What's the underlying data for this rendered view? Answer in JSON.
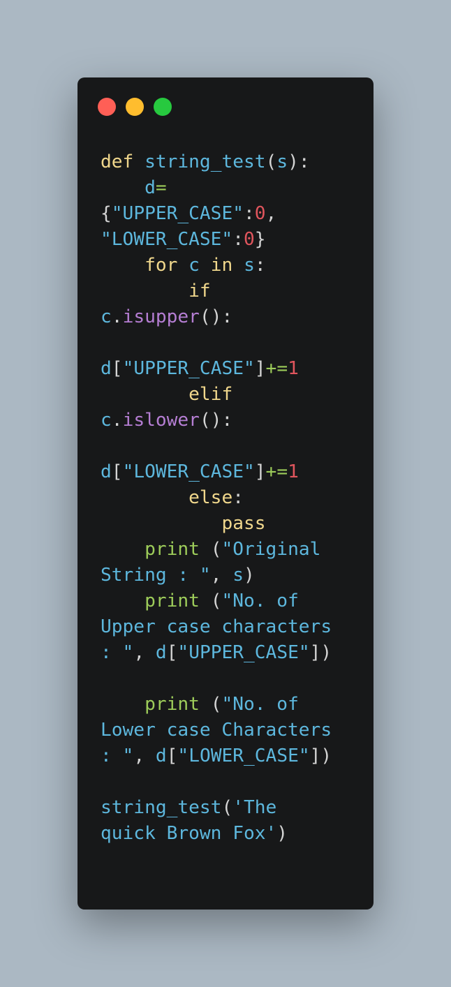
{
  "window": {
    "controls": [
      "close-button",
      "minimize-button",
      "maximize-button"
    ]
  },
  "code": {
    "language": "python",
    "lines": [
      [
        {
          "t": "kw",
          "v": "def"
        },
        {
          "t": "pn",
          "v": " "
        },
        {
          "t": "fn",
          "v": "string_test"
        },
        {
          "t": "pn",
          "v": "("
        },
        {
          "t": "id",
          "v": "s"
        },
        {
          "t": "pn",
          "v": "):"
        }
      ],
      [
        {
          "t": "pn",
          "v": "    "
        },
        {
          "t": "id",
          "v": "d"
        },
        {
          "t": "op",
          "v": "="
        }
      ],
      [
        {
          "t": "pn",
          "v": "{"
        },
        {
          "t": "str",
          "v": "\"UPPER_CASE\""
        },
        {
          "t": "pn",
          "v": ":"
        },
        {
          "t": "num",
          "v": "0"
        },
        {
          "t": "pn",
          "v": ","
        }
      ],
      [
        {
          "t": "str",
          "v": "\"LOWER_CASE\""
        },
        {
          "t": "pn",
          "v": ":"
        },
        {
          "t": "num",
          "v": "0"
        },
        {
          "t": "pn",
          "v": "}"
        }
      ],
      [
        {
          "t": "pn",
          "v": "    "
        },
        {
          "t": "kw",
          "v": "for"
        },
        {
          "t": "pn",
          "v": " "
        },
        {
          "t": "id",
          "v": "c"
        },
        {
          "t": "pn",
          "v": " "
        },
        {
          "t": "kw",
          "v": "in"
        },
        {
          "t": "pn",
          "v": " "
        },
        {
          "t": "id",
          "v": "s"
        },
        {
          "t": "pn",
          "v": ":"
        }
      ],
      [
        {
          "t": "pn",
          "v": "        "
        },
        {
          "t": "kw",
          "v": "if"
        }
      ],
      [
        {
          "t": "id",
          "v": "c"
        },
        {
          "t": "pn",
          "v": "."
        },
        {
          "t": "me",
          "v": "isupper"
        },
        {
          "t": "pn",
          "v": "():"
        }
      ],
      [],
      [
        {
          "t": "id",
          "v": "d"
        },
        {
          "t": "pn",
          "v": "["
        },
        {
          "t": "str",
          "v": "\"UPPER_CASE\""
        },
        {
          "t": "pn",
          "v": "]"
        },
        {
          "t": "op",
          "v": "+="
        },
        {
          "t": "num",
          "v": "1"
        }
      ],
      [
        {
          "t": "pn",
          "v": "        "
        },
        {
          "t": "kw",
          "v": "elif"
        }
      ],
      [
        {
          "t": "id",
          "v": "c"
        },
        {
          "t": "pn",
          "v": "."
        },
        {
          "t": "me",
          "v": "islower"
        },
        {
          "t": "pn",
          "v": "():"
        }
      ],
      [],
      [
        {
          "t": "id",
          "v": "d"
        },
        {
          "t": "pn",
          "v": "["
        },
        {
          "t": "str",
          "v": "\"LOWER_CASE\""
        },
        {
          "t": "pn",
          "v": "]"
        },
        {
          "t": "op",
          "v": "+="
        },
        {
          "t": "num",
          "v": "1"
        }
      ],
      [
        {
          "t": "pn",
          "v": "        "
        },
        {
          "t": "kw",
          "v": "else"
        },
        {
          "t": "pn",
          "v": ":"
        }
      ],
      [
        {
          "t": "pn",
          "v": "           "
        },
        {
          "t": "kw",
          "v": "pass"
        }
      ],
      [
        {
          "t": "pn",
          "v": "    "
        },
        {
          "t": "bi",
          "v": "print"
        },
        {
          "t": "pn",
          "v": " ("
        },
        {
          "t": "str",
          "v": "\"Original"
        }
      ],
      [
        {
          "t": "str",
          "v": "String : \""
        },
        {
          "t": "pn",
          "v": ", "
        },
        {
          "t": "id",
          "v": "s"
        },
        {
          "t": "pn",
          "v": ")"
        }
      ],
      [
        {
          "t": "pn",
          "v": "    "
        },
        {
          "t": "bi",
          "v": "print"
        },
        {
          "t": "pn",
          "v": " ("
        },
        {
          "t": "str",
          "v": "\"No. of"
        }
      ],
      [
        {
          "t": "str",
          "v": "Upper case characters"
        }
      ],
      [
        {
          "t": "str",
          "v": ": \""
        },
        {
          "t": "pn",
          "v": ", "
        },
        {
          "t": "id",
          "v": "d"
        },
        {
          "t": "pn",
          "v": "["
        },
        {
          "t": "str",
          "v": "\"UPPER_CASE\""
        },
        {
          "t": "pn",
          "v": "])"
        }
      ],
      [],
      [
        {
          "t": "pn",
          "v": "    "
        },
        {
          "t": "bi",
          "v": "print"
        },
        {
          "t": "pn",
          "v": " ("
        },
        {
          "t": "str",
          "v": "\"No. of"
        }
      ],
      [
        {
          "t": "str",
          "v": "Lower case Characters"
        }
      ],
      [
        {
          "t": "str",
          "v": ": \""
        },
        {
          "t": "pn",
          "v": ", "
        },
        {
          "t": "id",
          "v": "d"
        },
        {
          "t": "pn",
          "v": "["
        },
        {
          "t": "str",
          "v": "\"LOWER_CASE\""
        },
        {
          "t": "pn",
          "v": "])"
        }
      ],
      [],
      [
        {
          "t": "fn",
          "v": "string_test"
        },
        {
          "t": "pn",
          "v": "("
        },
        {
          "t": "str",
          "v": "'The"
        }
      ],
      [
        {
          "t": "str",
          "v": "quick Brown Fox'"
        },
        {
          "t": "pn",
          "v": ")"
        }
      ]
    ]
  }
}
